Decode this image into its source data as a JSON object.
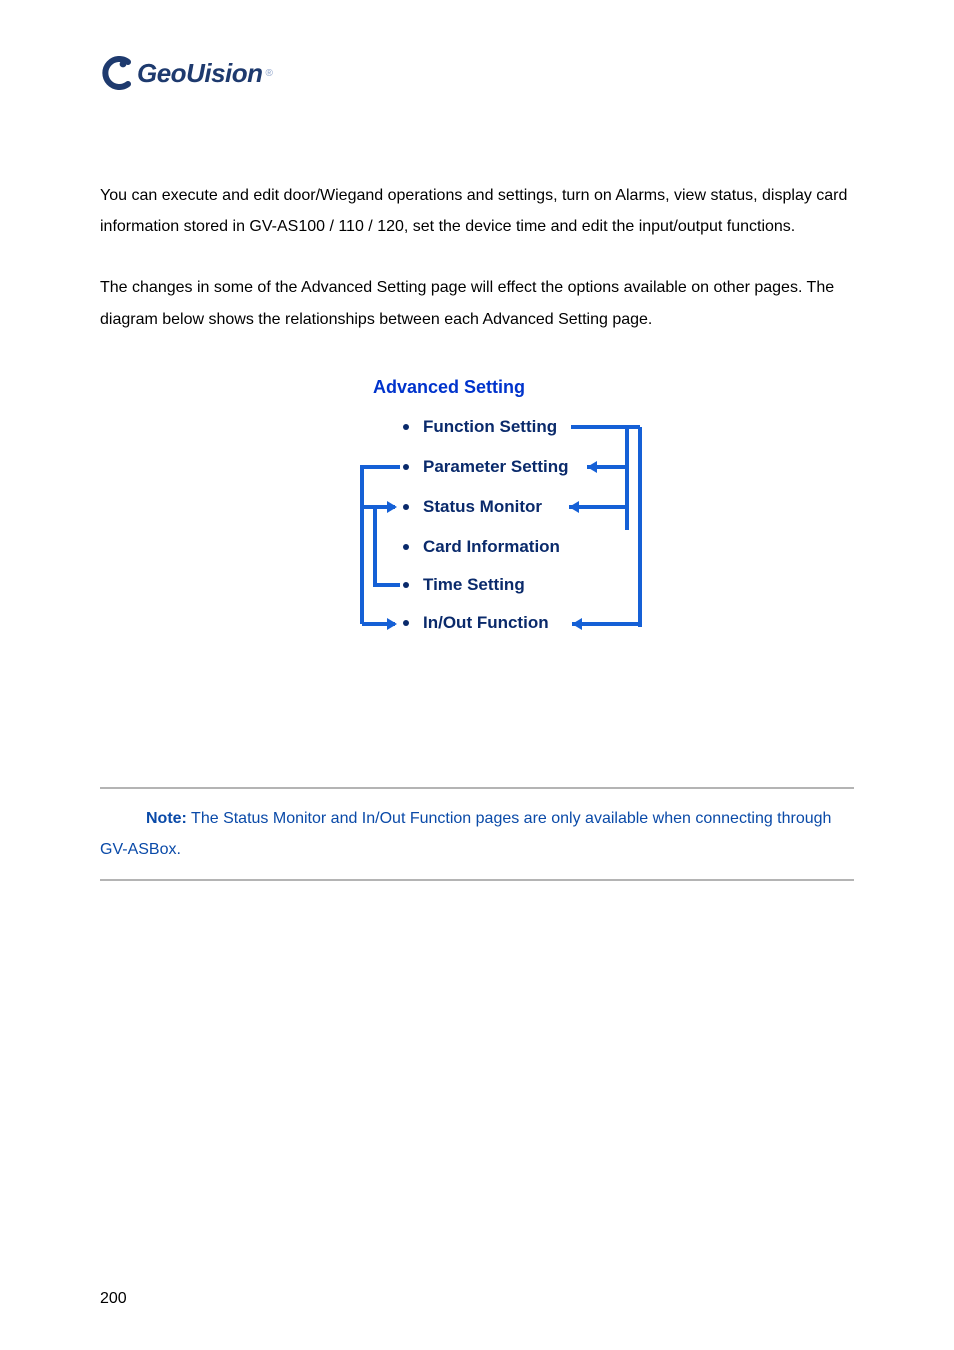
{
  "logo": {
    "text": "GeoUision"
  },
  "paragraphs": {
    "p1": "You can execute and edit door/Wiegand operations and settings, turn on Alarms, view status, display card information stored in GV-AS100 / 110 / 120, set the device time and edit the input/output functions.",
    "p2": "The changes in some of the Advanced Setting page will effect the options available on other pages. The diagram below shows the relationships between each Advanced Setting page."
  },
  "diagram": {
    "title": "Advanced Setting",
    "items": [
      "Function Setting",
      "Parameter Setting",
      "Status Monitor",
      "Card Information",
      "Time Setting",
      "In/Out Function"
    ]
  },
  "note": {
    "prefix": "Note:",
    "text": " The Status Monitor and In/Out Function pages are only available when connecting through GV-ASBox."
  },
  "pageNumber": "200"
}
